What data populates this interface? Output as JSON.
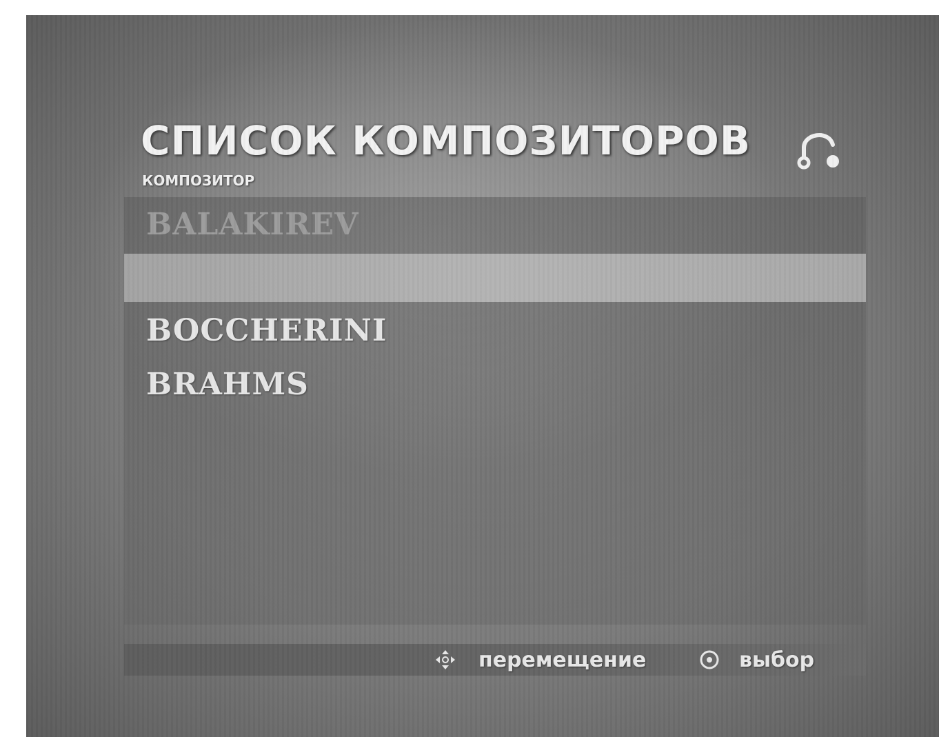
{
  "header": {
    "title": "СПИСОК КОМПОЗИТОРОВ",
    "subtitle": "КОМПОЗИТОР",
    "icon": "music-note-icon"
  },
  "list": {
    "items": [
      {
        "label": "BALAKIREV",
        "state": "dimmed"
      },
      {
        "label": "",
        "state": "selected"
      },
      {
        "label": "BOCCHERINI",
        "state": "normal"
      },
      {
        "label": "BRAHMS",
        "state": "normal"
      }
    ]
  },
  "footer": {
    "move_icon": "dpad-icon",
    "move_label": "перемещение",
    "select_icon": "enter-icon",
    "select_label": "выбор"
  }
}
